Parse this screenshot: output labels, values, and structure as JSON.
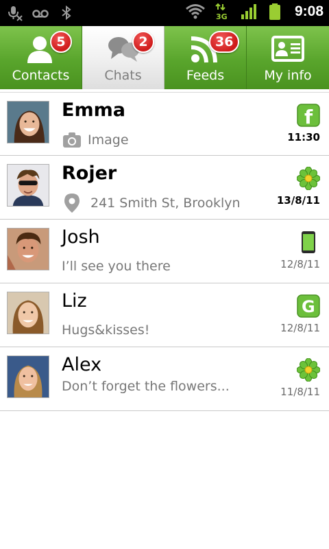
{
  "status_bar": {
    "time": "9:08",
    "network": "3G",
    "icons": [
      "mic-muted-icon",
      "voicemail-icon",
      "bluetooth-icon",
      "wifi-icon",
      "network-3g-icon",
      "signal-icon",
      "battery-icon"
    ]
  },
  "tabs": [
    {
      "label": "Contacts",
      "icon": "contacts-icon",
      "badge": "5",
      "active": false
    },
    {
      "label": "Chats",
      "icon": "chats-icon",
      "badge": "2",
      "active": true
    },
    {
      "label": "Feeds",
      "icon": "feeds-icon",
      "badge": "36",
      "active": false
    },
    {
      "label": "My info",
      "icon": "my-info-icon",
      "badge": "",
      "active": false
    }
  ],
  "chats": [
    {
      "name": "Emma",
      "preview": "Image",
      "preview_icon": "camera-icon",
      "time": "11:30",
      "source": "facebook-icon",
      "unread": true
    },
    {
      "name": "Rojer",
      "preview": "241 Smith St, Brooklyn",
      "preview_icon": "location-pin-icon",
      "time": "13/8/11",
      "source": "icq-flower-icon",
      "unread": true
    },
    {
      "name": "Josh",
      "preview": "I’ll see you there",
      "preview_icon": "",
      "time": "12/8/11",
      "source": "phone-sms-icon",
      "unread": false
    },
    {
      "name": "Liz",
      "preview": "Hugs&kisses!",
      "preview_icon": "",
      "time": "12/8/11",
      "source": "google-talk-icon",
      "unread": false
    },
    {
      "name": "Alex",
      "preview": "Don’t forget the flowers...",
      "preview_icon": "",
      "time": "11/8/11",
      "source": "icq-flower-icon",
      "unread": false
    }
  ],
  "colors": {
    "tab_green": "#5aa62d",
    "badge_red": "#d42020",
    "status_green": "#9acd32"
  }
}
